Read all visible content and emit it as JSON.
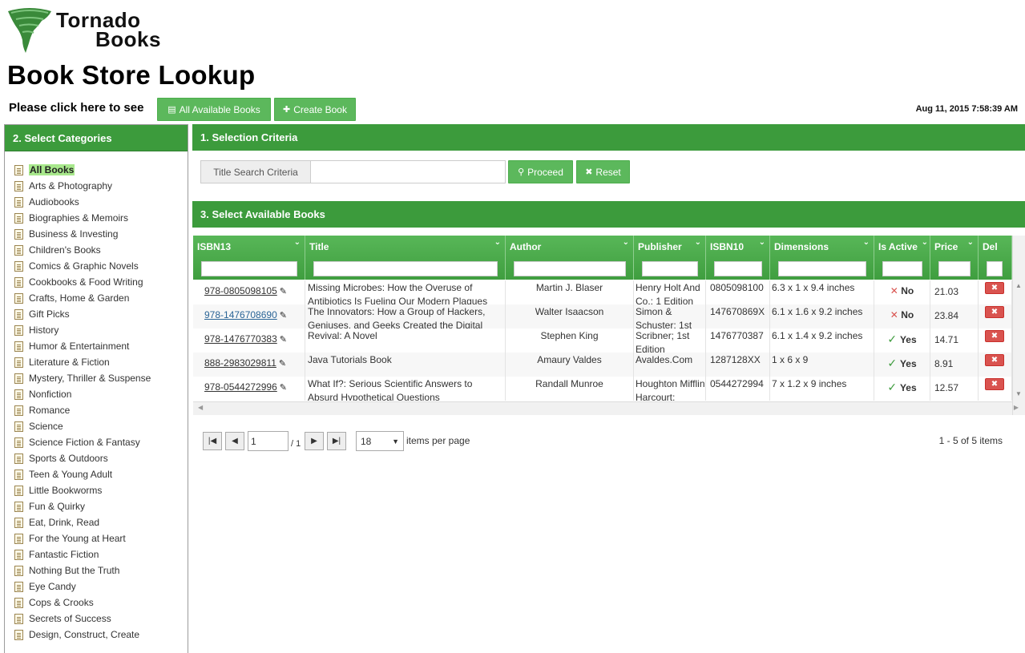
{
  "logo": {
    "line1": "Tornado",
    "line2": "Books"
  },
  "page_title": "Book Store Lookup",
  "see_label": "Please click here to see",
  "buttons": {
    "all_books": "All Available Books",
    "create_book": "Create Book",
    "proceed": "Proceed",
    "reset": "Reset"
  },
  "timestamp": "Aug 11, 2015 7:58:39 AM",
  "categories_panel": {
    "title": "2. Select Categories",
    "items": [
      "All Books",
      "Arts & Photography",
      "Audiobooks",
      "Biographies & Memoirs",
      "Business & Investing",
      "Children's Books",
      "Comics & Graphic Novels",
      "Cookbooks & Food Writing",
      "Crafts, Home & Garden",
      "Gift Picks",
      "History",
      "Humor & Entertainment",
      "Literature & Fiction",
      "Mystery, Thriller & Suspense",
      "Nonfiction",
      "Romance",
      "Science",
      "Science Fiction & Fantasy",
      "Sports & Outdoors",
      "Teen & Young Adult",
      "Little Bookworms",
      "Fun & Quirky",
      "Eat, Drink, Read",
      "For the Young at Heart",
      "Fantastic Fiction",
      "Nothing But the Truth",
      "Eye Candy",
      "Cops & Crooks",
      "Secrets of Success",
      "Design, Construct, Create"
    ],
    "selected": "All Books"
  },
  "criteria_panel": {
    "title": "1. Selection Criteria",
    "search_label": "Title Search Criteria",
    "search_value": ""
  },
  "books_panel": {
    "title": "3. Select Available Books",
    "columns": [
      "ISBN13",
      "Title",
      "Author",
      "Publisher",
      "ISBN10",
      "Dimensions",
      "Is Active",
      "Price",
      "Del"
    ],
    "rows": [
      {
        "isbn13": "978-0805098105",
        "title": "Missing Microbes: How the Overuse of Antibiotics Is Fueling Our Modern Plagues",
        "author": "Martin J. Blaser",
        "publisher": "Henry Holt And Co.; 1 Edition",
        "isbn10": "0805098100",
        "dimensions": "6.3 x 1 x 9.4 inches",
        "active": "No",
        "price": "21.03",
        "del": "✖"
      },
      {
        "isbn13": "978-1476708690",
        "title": "The Innovators: How a Group of Hackers, Geniuses, and Geeks Created the Digital",
        "author": "Walter Isaacson",
        "publisher": "Simon & Schuster; 1st",
        "isbn10": "147670869X",
        "dimensions": "6.1 x 1.6 x 9.2 inches",
        "active": "No",
        "price": "23.84",
        "del": "✖"
      },
      {
        "isbn13": "978-1476770383",
        "title": "Revival: A Novel",
        "author": "Stephen King",
        "publisher": "Scribner; 1st Edition",
        "isbn10": "1476770387",
        "dimensions": "6.1 x 1.4 x 9.2 inches",
        "active": "Yes",
        "price": "14.71",
        "del": "✖"
      },
      {
        "isbn13": "888-2983029811",
        "title": "Java Tutorials Book",
        "author": "Amaury Valdes",
        "publisher": "Avaldes.Com",
        "isbn10": "1287128XX",
        "dimensions": "1 x 6 x 9",
        "active": "Yes",
        "price": "8.91",
        "del": "✖"
      },
      {
        "isbn13": "978-0544272996",
        "title": "What If?: Serious Scientific Answers to Absurd Hypothetical Questions",
        "author": "Randall Munroe",
        "publisher": "Houghton Mifflin Harcourt;",
        "isbn10": "0544272994",
        "dimensions": "7 x 1.2 x 9 inches",
        "active": "Yes",
        "price": "12.57",
        "del": "✖"
      }
    ]
  },
  "pager": {
    "page": "1",
    "of_pages": "/ 1",
    "per_page": "18",
    "items_per_page_label": "items per page",
    "info": "1 - 5 of 5 items"
  },
  "icons": {
    "book": "book-icon",
    "plus": "plus-icon",
    "search": "search-icon",
    "reset": "close-icon",
    "edit": "pencil-icon",
    "category": "document-icon"
  },
  "colors": {
    "brand_green": "#3c9b3c",
    "button_green": "#5cb85c",
    "delete_red": "#d9534f",
    "selected_category": "#a8e88c"
  }
}
